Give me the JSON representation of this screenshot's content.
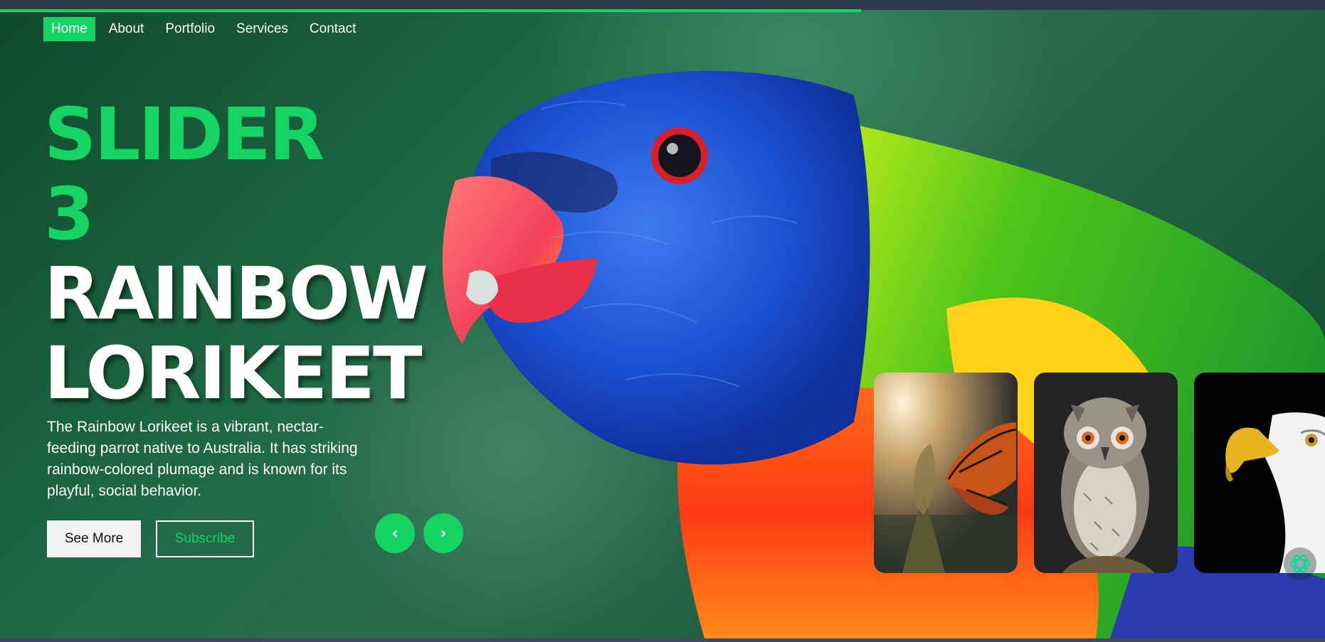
{
  "nav": {
    "items": [
      {
        "label": "Home"
      },
      {
        "label": "About"
      },
      {
        "label": "Portfolio"
      },
      {
        "label": "Services"
      },
      {
        "label": "Contact"
      }
    ]
  },
  "hero": {
    "title_line1": "SLIDER",
    "title_line2": "3",
    "title_line3": "RAINBOW",
    "title_line4": "LORIKEET",
    "description": "The Rainbow Lorikeet is a vibrant, nectar-feeding parrot native to Australia. It has striking rainbow-colored plumage and is known for its playful, social behavior.",
    "see_more_label": "See More",
    "subscribe_label": "Subscribe",
    "prev_label": "‹",
    "next_label": "›"
  },
  "thumbnails": [
    {
      "subject": "butterfly"
    },
    {
      "subject": "owl"
    },
    {
      "subject": "eagle"
    }
  ],
  "slider_progress_percent": 65,
  "colors": {
    "accent": "#15d464",
    "background": "#1f6b45"
  },
  "icons": {
    "ai_badge": "openai-icon"
  }
}
